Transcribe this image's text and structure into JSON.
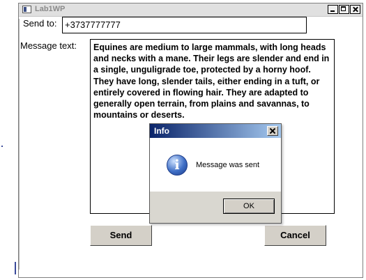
{
  "window": {
    "title": "Lab1WP"
  },
  "form": {
    "send_to_label": "Send to:",
    "send_to_value": "+3737777777",
    "message_label": "Message text:",
    "message_value": "Equines are medium to large mammals, with long heads and necks with a mane. Their legs are slender and end in a single, unguligrade toe, protected by a horny hoof. They have long, slender tails, either ending in a tuft, or entirely covered in flowing hair. They are adapted to generally open terrain, from plains and savannas, to mountains or deserts.",
    "send_button": "Send",
    "cancel_button": "Cancel"
  },
  "dialog": {
    "title": "Info",
    "icon": "info-icon",
    "message": "Message was sent",
    "ok_button": "OK"
  }
}
